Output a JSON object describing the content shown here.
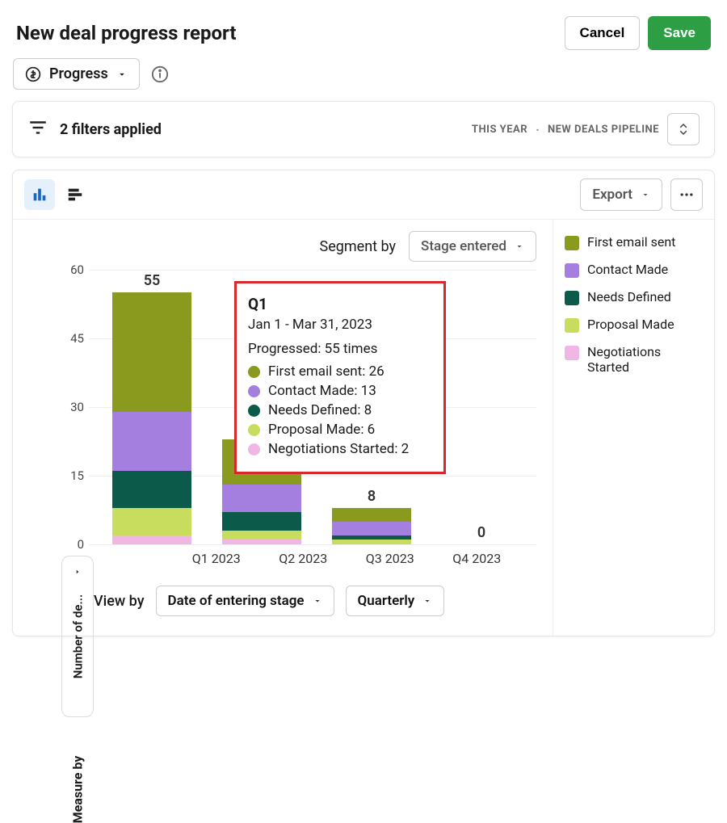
{
  "header": {
    "title": "New deal progress report",
    "cancel": "Cancel",
    "save": "Save"
  },
  "progress_pill": "Progress",
  "filters": {
    "summary": "2 filters applied",
    "chips": [
      "THIS YEAR",
      "NEW DEALS PIPELINE"
    ]
  },
  "export_label": "Export",
  "segment": {
    "label": "Segment by",
    "value": "Stage entered"
  },
  "legend": [
    {
      "name": "First email sent",
      "color": "#8a9a1f"
    },
    {
      "name": "Contact Made",
      "color": "#a57fe0"
    },
    {
      "name": "Needs Defined",
      "color": "#0c5a4a"
    },
    {
      "name": "Proposal Made",
      "color": "#c8dd5e"
    },
    {
      "name": "Negotiations Started",
      "color": "#f0b7e4"
    }
  ],
  "yaxis": {
    "label": "Number of de...",
    "ticks": [
      "0",
      "15",
      "30",
      "45",
      "60"
    ]
  },
  "measure_by": "Measure by",
  "viewby": {
    "label": "View by",
    "option1": "Date of entering stage",
    "option2": "Quarterly"
  },
  "xaxis": [
    "Q1 2023",
    "Q2 2023",
    "Q3 2023",
    "Q4 2023"
  ],
  "bar_totals": [
    "55",
    "",
    "8",
    "0"
  ],
  "tooltip": {
    "title": "Q1",
    "range": "Jan 1 - Mar 31, 2023",
    "progressed": "Progressed: 55 times",
    "rows": [
      {
        "label": "First email sent: 26",
        "color": "#8a9a1f"
      },
      {
        "label": "Contact Made: 13",
        "color": "#a57fe0"
      },
      {
        "label": "Needs Defined: 8",
        "color": "#0c5a4a"
      },
      {
        "label": "Proposal Made: 6",
        "color": "#c8dd5e"
      },
      {
        "label": "Negotiations Started: 2",
        "color": "#f0b7e4"
      }
    ]
  },
  "chart_data": {
    "type": "bar",
    "stacked": true,
    "title": "New deal progress report",
    "xlabel": "Date of entering stage (Quarterly)",
    "ylabel": "Number of deals",
    "ylim": [
      0,
      60
    ],
    "categories": [
      "Q1 2023",
      "Q2 2023",
      "Q3 2023",
      "Q4 2023"
    ],
    "series": [
      {
        "name": "First email sent",
        "color": "#8a9a1f",
        "values": [
          26,
          10,
          3,
          0
        ]
      },
      {
        "name": "Contact Made",
        "color": "#a57fe0",
        "values": [
          13,
          6,
          3,
          0
        ]
      },
      {
        "name": "Needs Defined",
        "color": "#0c5a4a",
        "values": [
          8,
          4,
          1,
          0
        ]
      },
      {
        "name": "Proposal Made",
        "color": "#c8dd5e",
        "values": [
          6,
          2,
          1,
          0
        ]
      },
      {
        "name": "Negotiations Started",
        "color": "#f0b7e4",
        "values": [
          2,
          1,
          0,
          0
        ]
      }
    ],
    "totals": [
      55,
      23,
      8,
      0
    ]
  }
}
